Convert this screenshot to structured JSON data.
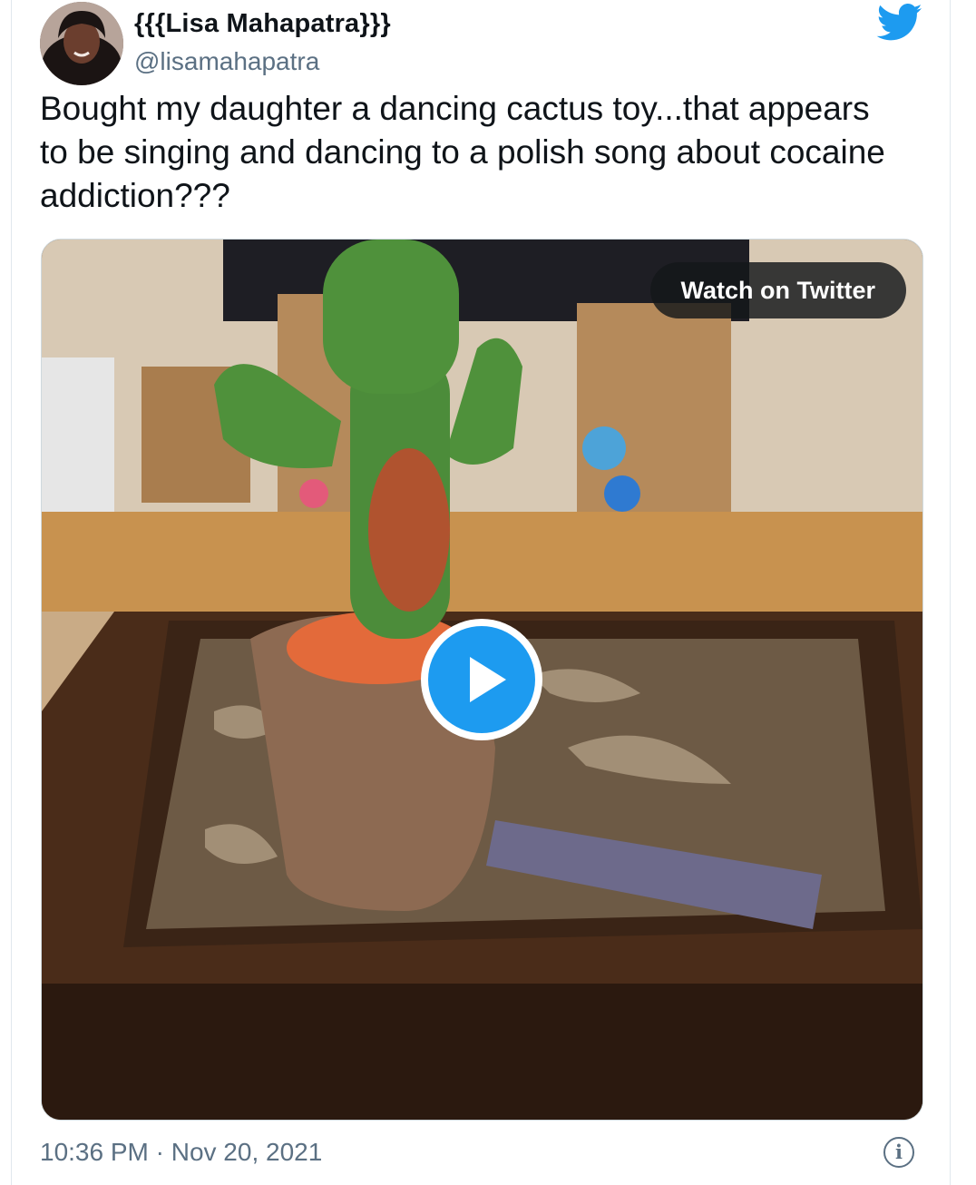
{
  "tweet": {
    "author": {
      "display_name": "{{{Lisa Mahapatra}}}",
      "handle": "@lisamahapatra",
      "avatar_icon": "user-avatar"
    },
    "brand_icon": "twitter-bird-icon",
    "brand_color": "#1d9bf0",
    "text": "Bought my daughter a dancing cactus toy...that appears to be singing and dancing to a polish song about cocaine addiction???",
    "media": {
      "type": "video",
      "watch_label": "Watch on Twitter",
      "play_icon": "play-icon"
    },
    "timestamp": "10:36 PM · Nov 20, 2021",
    "info_icon": "info-icon"
  }
}
